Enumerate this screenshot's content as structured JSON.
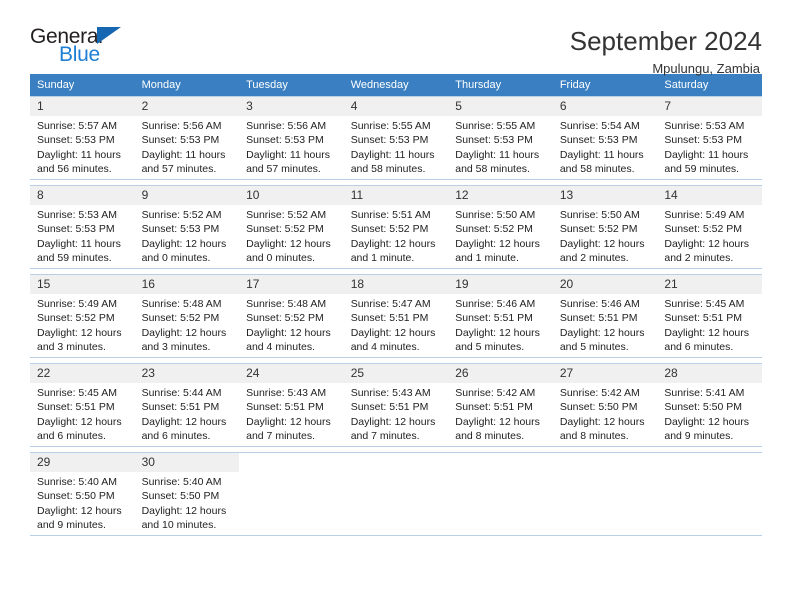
{
  "brand": {
    "name_top": "General",
    "name_bottom": "Blue",
    "triangle_icon": "triangle-icon",
    "color_black": "#231f20",
    "color_blue": "#1e7fd4"
  },
  "header": {
    "title": "September 2024",
    "location": "Mpulungu, Zambia"
  },
  "theme": {
    "header_bg": "#3a7fc1",
    "daynum_bg": "#f0f0f0",
    "border": "#b9cfe4"
  },
  "weekdays": [
    "Sunday",
    "Monday",
    "Tuesday",
    "Wednesday",
    "Thursday",
    "Friday",
    "Saturday"
  ],
  "weeks": [
    [
      {
        "day": "1",
        "sunrise": "Sunrise: 5:57 AM",
        "sunset": "Sunset: 5:53 PM",
        "daylight_a": "Daylight: 11 hours",
        "daylight_b": "and 56 minutes."
      },
      {
        "day": "2",
        "sunrise": "Sunrise: 5:56 AM",
        "sunset": "Sunset: 5:53 PM",
        "daylight_a": "Daylight: 11 hours",
        "daylight_b": "and 57 minutes."
      },
      {
        "day": "3",
        "sunrise": "Sunrise: 5:56 AM",
        "sunset": "Sunset: 5:53 PM",
        "daylight_a": "Daylight: 11 hours",
        "daylight_b": "and 57 minutes."
      },
      {
        "day": "4",
        "sunrise": "Sunrise: 5:55 AM",
        "sunset": "Sunset: 5:53 PM",
        "daylight_a": "Daylight: 11 hours",
        "daylight_b": "and 58 minutes."
      },
      {
        "day": "5",
        "sunrise": "Sunrise: 5:55 AM",
        "sunset": "Sunset: 5:53 PM",
        "daylight_a": "Daylight: 11 hours",
        "daylight_b": "and 58 minutes."
      },
      {
        "day": "6",
        "sunrise": "Sunrise: 5:54 AM",
        "sunset": "Sunset: 5:53 PM",
        "daylight_a": "Daylight: 11 hours",
        "daylight_b": "and 58 minutes."
      },
      {
        "day": "7",
        "sunrise": "Sunrise: 5:53 AM",
        "sunset": "Sunset: 5:53 PM",
        "daylight_a": "Daylight: 11 hours",
        "daylight_b": "and 59 minutes."
      }
    ],
    [
      {
        "day": "8",
        "sunrise": "Sunrise: 5:53 AM",
        "sunset": "Sunset: 5:53 PM",
        "daylight_a": "Daylight: 11 hours",
        "daylight_b": "and 59 minutes."
      },
      {
        "day": "9",
        "sunrise": "Sunrise: 5:52 AM",
        "sunset": "Sunset: 5:53 PM",
        "daylight_a": "Daylight: 12 hours",
        "daylight_b": "and 0 minutes."
      },
      {
        "day": "10",
        "sunrise": "Sunrise: 5:52 AM",
        "sunset": "Sunset: 5:52 PM",
        "daylight_a": "Daylight: 12 hours",
        "daylight_b": "and 0 minutes."
      },
      {
        "day": "11",
        "sunrise": "Sunrise: 5:51 AM",
        "sunset": "Sunset: 5:52 PM",
        "daylight_a": "Daylight: 12 hours",
        "daylight_b": "and 1 minute."
      },
      {
        "day": "12",
        "sunrise": "Sunrise: 5:50 AM",
        "sunset": "Sunset: 5:52 PM",
        "daylight_a": "Daylight: 12 hours",
        "daylight_b": "and 1 minute."
      },
      {
        "day": "13",
        "sunrise": "Sunrise: 5:50 AM",
        "sunset": "Sunset: 5:52 PM",
        "daylight_a": "Daylight: 12 hours",
        "daylight_b": "and 2 minutes."
      },
      {
        "day": "14",
        "sunrise": "Sunrise: 5:49 AM",
        "sunset": "Sunset: 5:52 PM",
        "daylight_a": "Daylight: 12 hours",
        "daylight_b": "and 2 minutes."
      }
    ],
    [
      {
        "day": "15",
        "sunrise": "Sunrise: 5:49 AM",
        "sunset": "Sunset: 5:52 PM",
        "daylight_a": "Daylight: 12 hours",
        "daylight_b": "and 3 minutes."
      },
      {
        "day": "16",
        "sunrise": "Sunrise: 5:48 AM",
        "sunset": "Sunset: 5:52 PM",
        "daylight_a": "Daylight: 12 hours",
        "daylight_b": "and 3 minutes."
      },
      {
        "day": "17",
        "sunrise": "Sunrise: 5:48 AM",
        "sunset": "Sunset: 5:52 PM",
        "daylight_a": "Daylight: 12 hours",
        "daylight_b": "and 4 minutes."
      },
      {
        "day": "18",
        "sunrise": "Sunrise: 5:47 AM",
        "sunset": "Sunset: 5:51 PM",
        "daylight_a": "Daylight: 12 hours",
        "daylight_b": "and 4 minutes."
      },
      {
        "day": "19",
        "sunrise": "Sunrise: 5:46 AM",
        "sunset": "Sunset: 5:51 PM",
        "daylight_a": "Daylight: 12 hours",
        "daylight_b": "and 5 minutes."
      },
      {
        "day": "20",
        "sunrise": "Sunrise: 5:46 AM",
        "sunset": "Sunset: 5:51 PM",
        "daylight_a": "Daylight: 12 hours",
        "daylight_b": "and 5 minutes."
      },
      {
        "day": "21",
        "sunrise": "Sunrise: 5:45 AM",
        "sunset": "Sunset: 5:51 PM",
        "daylight_a": "Daylight: 12 hours",
        "daylight_b": "and 6 minutes."
      }
    ],
    [
      {
        "day": "22",
        "sunrise": "Sunrise: 5:45 AM",
        "sunset": "Sunset: 5:51 PM",
        "daylight_a": "Daylight: 12 hours",
        "daylight_b": "and 6 minutes."
      },
      {
        "day": "23",
        "sunrise": "Sunrise: 5:44 AM",
        "sunset": "Sunset: 5:51 PM",
        "daylight_a": "Daylight: 12 hours",
        "daylight_b": "and 6 minutes."
      },
      {
        "day": "24",
        "sunrise": "Sunrise: 5:43 AM",
        "sunset": "Sunset: 5:51 PM",
        "daylight_a": "Daylight: 12 hours",
        "daylight_b": "and 7 minutes."
      },
      {
        "day": "25",
        "sunrise": "Sunrise: 5:43 AM",
        "sunset": "Sunset: 5:51 PM",
        "daylight_a": "Daylight: 12 hours",
        "daylight_b": "and 7 minutes."
      },
      {
        "day": "26",
        "sunrise": "Sunrise: 5:42 AM",
        "sunset": "Sunset: 5:51 PM",
        "daylight_a": "Daylight: 12 hours",
        "daylight_b": "and 8 minutes."
      },
      {
        "day": "27",
        "sunrise": "Sunrise: 5:42 AM",
        "sunset": "Sunset: 5:50 PM",
        "daylight_a": "Daylight: 12 hours",
        "daylight_b": "and 8 minutes."
      },
      {
        "day": "28",
        "sunrise": "Sunrise: 5:41 AM",
        "sunset": "Sunset: 5:50 PM",
        "daylight_a": "Daylight: 12 hours",
        "daylight_b": "and 9 minutes."
      }
    ],
    [
      {
        "day": "29",
        "sunrise": "Sunrise: 5:40 AM",
        "sunset": "Sunset: 5:50 PM",
        "daylight_a": "Daylight: 12 hours",
        "daylight_b": "and 9 minutes."
      },
      {
        "day": "30",
        "sunrise": "Sunrise: 5:40 AM",
        "sunset": "Sunset: 5:50 PM",
        "daylight_a": "Daylight: 12 hours",
        "daylight_b": "and 10 minutes."
      },
      null,
      null,
      null,
      null,
      null
    ]
  ]
}
